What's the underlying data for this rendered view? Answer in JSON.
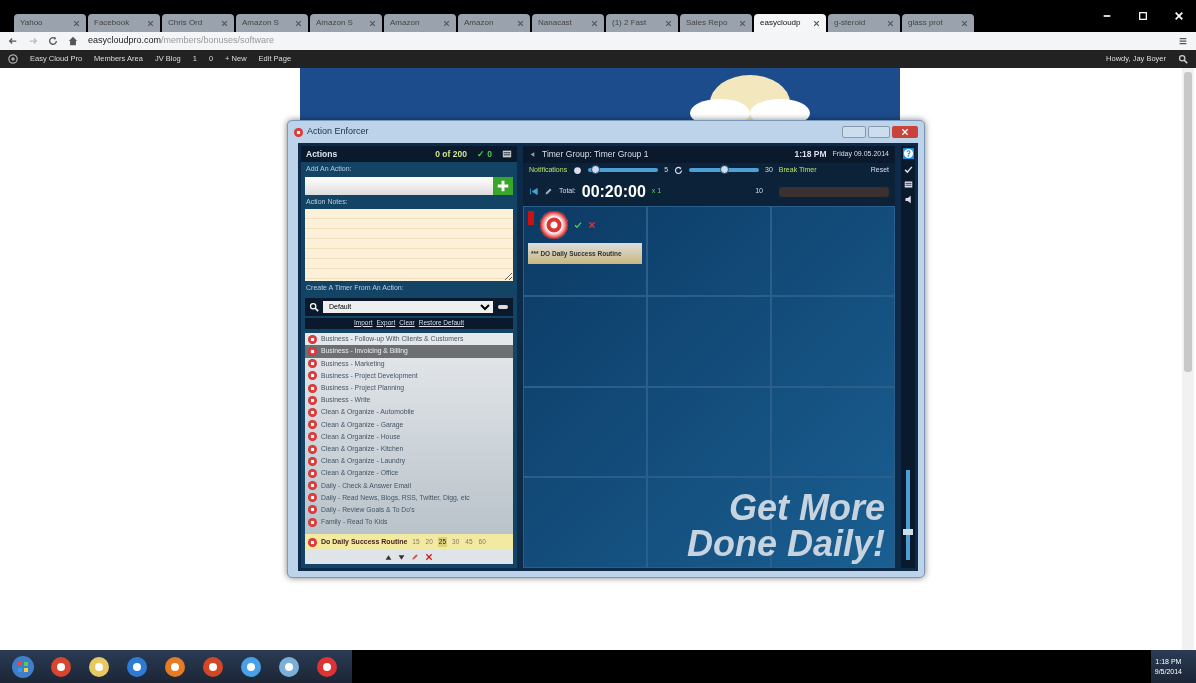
{
  "browser": {
    "tabs": [
      {
        "label": "Yahoo",
        "selected": false
      },
      {
        "label": "Facebook",
        "selected": false
      },
      {
        "label": "Chris Ord",
        "selected": false
      },
      {
        "label": "Amazon S",
        "selected": false
      },
      {
        "label": "Amazon S",
        "selected": false
      },
      {
        "label": "Amazon",
        "selected": false
      },
      {
        "label": "Amazon",
        "selected": false
      },
      {
        "label": "Nanacast",
        "selected": false
      },
      {
        "label": "(1) 2 Fast",
        "selected": false
      },
      {
        "label": "Sales Repo",
        "selected": false
      },
      {
        "label": "easycloudp",
        "selected": true
      },
      {
        "label": "g-steroid",
        "selected": false
      },
      {
        "label": "glass prot",
        "selected": false
      }
    ],
    "url_host": "easycloudpro.com",
    "url_path": "/members/bonuses/software"
  },
  "admin_bar": {
    "items": [
      "Easy Cloud Pro",
      "Members Area",
      "JV Blog",
      "1",
      "0",
      "+ New",
      "Edit Page"
    ],
    "greeting": "Howdy, Jay Boyer"
  },
  "app": {
    "title": "Action Enforcer",
    "left": {
      "heading": "Actions",
      "count": "0 of 200",
      "done": "✓ 0",
      "add_label": "Add An Action:",
      "notes_label": "Action Notes:",
      "timer_label": "Create A Timer From An Action:",
      "select_value": "Default",
      "links": [
        "Import",
        "Export",
        "Clear",
        "Restore Default"
      ],
      "actions": [
        {
          "label": "Business - Follow-up With Clients & Customers",
          "selected": false
        },
        {
          "label": "Business - Invoicing & Billing",
          "selected": true
        },
        {
          "label": "Business - Marketing",
          "selected": false
        },
        {
          "label": "Business - Project Development",
          "selected": false
        },
        {
          "label": "Business - Project Planning",
          "selected": false
        },
        {
          "label": "Business - Write",
          "selected": false
        },
        {
          "label": "Clean & Organize - Automobile",
          "selected": false
        },
        {
          "label": "Clean & Organize - Garage",
          "selected": false
        },
        {
          "label": "Clean & Organize - House",
          "selected": false
        },
        {
          "label": "Clean & Organize - Kitchen",
          "selected": false
        },
        {
          "label": "Clean & Organize - Laundry",
          "selected": false
        },
        {
          "label": "Clean & Organize - Office",
          "selected": false
        },
        {
          "label": "Daily - Check & Answer Email",
          "selected": false
        },
        {
          "label": "Daily - Read News, Blogs, RSS, Twitter, Digg, etc",
          "selected": false
        },
        {
          "label": "Daily - Review Goals & To Do's",
          "selected": false
        },
        {
          "label": "Family - Read To Kids",
          "selected": false
        }
      ],
      "current": "Do Daily Success Routine",
      "minutes": [
        {
          "label": "15",
          "selected": false
        },
        {
          "label": "20",
          "selected": false
        },
        {
          "label": "25",
          "selected": true
        },
        {
          "label": "30",
          "selected": false
        },
        {
          "label": "45",
          "selected": false
        },
        {
          "label": "60",
          "selected": false
        }
      ]
    },
    "right": {
      "group_title": "Timer Group: Timer Group 1",
      "time": "1:18 PM",
      "date": "Friday 09.05.2014",
      "notifications": "Notifications",
      "volume": {
        "level": 0.05,
        "reading": "5"
      },
      "repeat": {
        "level": 0.5,
        "reading": "30"
      },
      "break_label": "Break Timer",
      "reset": "Reset",
      "total_label": "Total:",
      "total": "00:20:00",
      "multiplier": "x 1",
      "break_count": "10",
      "timer_name": "*** DO Daily Success Routine",
      "side_volume": {
        "level": 0.3
      },
      "slogan_1": "Get More",
      "slogan_2": "Done Daily!"
    }
  },
  "taskbar": {
    "time": "1:18 PM",
    "date": "9/5/2014"
  }
}
